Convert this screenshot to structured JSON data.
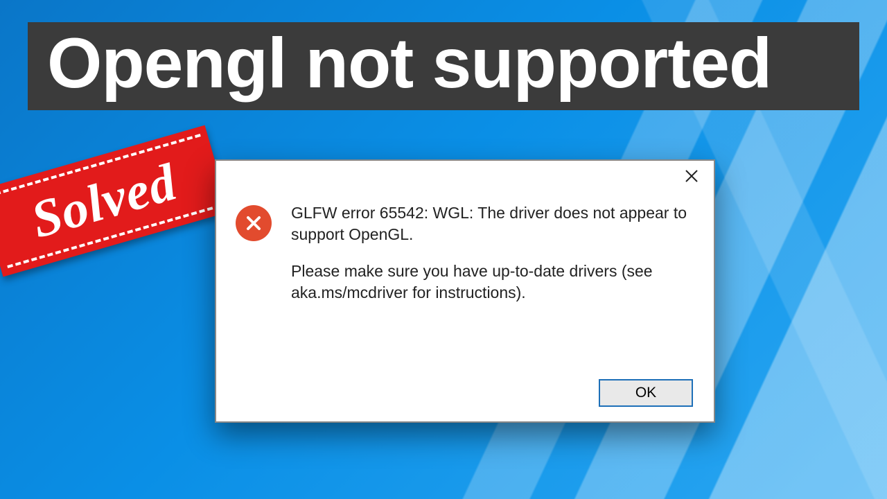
{
  "headline": {
    "text": "Opengl not supported"
  },
  "stamp": {
    "text": "Solved"
  },
  "dialog": {
    "close_label": "Close",
    "error_icon_label": "error",
    "message_line1": "GLFW error 65542: WGL: The driver does not appear to support OpenGL.",
    "message_line2": "Please make sure you have up-to-date drivers (see aka.ms/mcdriver for instructions).",
    "ok_label": "OK"
  },
  "colors": {
    "banner_bg": "#3b3b3b",
    "stamp_bg": "#e21b1b",
    "error_icon_bg": "#e24b2e",
    "ok_border": "#1d6fb8"
  }
}
